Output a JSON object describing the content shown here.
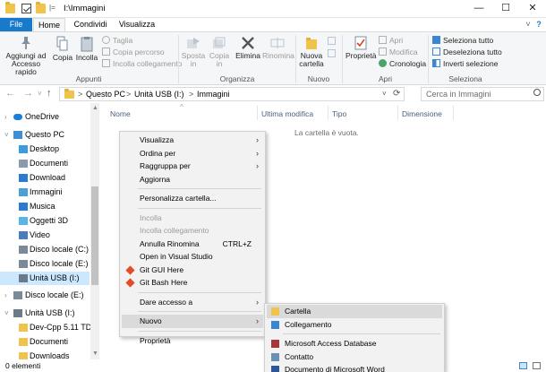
{
  "window": {
    "title": "I:\\Immagini",
    "qa_sep": "|=",
    "btn_min": "—",
    "btn_max": "☐",
    "btn_close": "✕",
    "help": "?"
  },
  "tabs": {
    "file": "File",
    "home": "Home",
    "share": "Condividi",
    "view": "Visualizza"
  },
  "ribbon": {
    "clipboard": {
      "pin": "Aggiungi ad\nAccesso rapido",
      "copy": "Copia",
      "paste": "Incolla",
      "cut": "Taglia",
      "copy_path": "Copia percorso",
      "paste_shortcut": "Incolla collegamento",
      "group": "Appunti"
    },
    "organize": {
      "move_to": "Sposta\nin",
      "copy_to": "Copia\nin",
      "delete": "Elimina",
      "rename": "Rinomina",
      "group": "Organizza"
    },
    "new": {
      "new_folder": "Nuova\ncartella",
      "group": "Nuovo"
    },
    "open": {
      "properties": "Proprietà",
      "open": "Apri",
      "edit": "Modifica",
      "history": "Cronologia",
      "group": "Apri"
    },
    "select": {
      "select_all": "Seleziona tutto",
      "select_none": "Deseleziona tutto",
      "invert": "Inverti selezione",
      "group": "Seleziona"
    }
  },
  "address": {
    "crumbs": [
      "Questo PC",
      "Unità USB (I:)",
      "Immagini"
    ],
    "sep": ">",
    "search_placeholder": "Cerca in Immagini"
  },
  "nav": [
    {
      "label": "OneDrive",
      "icon": "cloud-icon",
      "color": "#1a7fd8",
      "indent": 0
    },
    {
      "label": "Questo PC",
      "icon": "pc-icon",
      "color": "#3b8fd6",
      "indent": 0
    },
    {
      "label": "Desktop",
      "icon": "desktop-icon",
      "color": "#3c9be0",
      "indent": 1
    },
    {
      "label": "Documenti",
      "icon": "documents-icon",
      "color": "#8a9bb0",
      "indent": 1
    },
    {
      "label": "Download",
      "icon": "download-icon",
      "color": "#2a7ad0",
      "indent": 1
    },
    {
      "label": "Immagini",
      "icon": "pictures-icon",
      "color": "#4aa0d9",
      "indent": 1
    },
    {
      "label": "Musica",
      "icon": "music-icon",
      "color": "#2a7ad0",
      "indent": 1
    },
    {
      "label": "Oggetti 3D",
      "icon": "3d-objects-icon",
      "color": "#56b6e8",
      "indent": 1
    },
    {
      "label": "Video",
      "icon": "video-icon",
      "color": "#4a7cc0",
      "indent": 1
    },
    {
      "label": "Disco locale (C:)",
      "icon": "drive-icon",
      "color": "#7a8a9a",
      "indent": 1
    },
    {
      "label": "Disco locale (E:)",
      "icon": "drive-icon",
      "color": "#7a8a9a",
      "indent": 1
    },
    {
      "label": "Unità USB (I:)",
      "icon": "usb-icon",
      "color": "#6b7a88",
      "indent": 1
    },
    {
      "label": "Disco locale (E:)",
      "icon": "drive-icon",
      "color": "#7a8a9a",
      "indent": 0
    },
    {
      "label": "Unità USB (I:)",
      "icon": "usb-icon",
      "color": "#6b7a88",
      "indent": 0
    },
    {
      "label": "Dev-Cpp 5.11 TDM",
      "icon": "folder-icon",
      "color": "#f0c34b",
      "indent": 1
    },
    {
      "label": "Documenti",
      "icon": "folder-icon",
      "color": "#f0c34b",
      "indent": 1
    },
    {
      "label": "Downloads",
      "icon": "folder-icon",
      "color": "#f0c34b",
      "indent": 1
    }
  ],
  "columns": {
    "name": "Nome",
    "modified": "Ultima modifica",
    "type": "Tipo",
    "size": "Dimensione"
  },
  "empty_message": "La cartella è vuota.",
  "status": "0 elementi",
  "context_menu": [
    {
      "label": "Visualizza",
      "arrow": true
    },
    {
      "label": "Ordina per",
      "arrow": true
    },
    {
      "label": "Raggruppa per",
      "arrow": true
    },
    {
      "label": "Aggiorna"
    },
    {
      "sep": true
    },
    {
      "label": "Personalizza cartella..."
    },
    {
      "sep": true
    },
    {
      "label": "Incolla",
      "disabled": true
    },
    {
      "label": "Incolla collegamento",
      "disabled": true
    },
    {
      "label": "Annulla Rinomina",
      "shortcut": "CTRL+Z"
    },
    {
      "label": "Open in Visual Studio"
    },
    {
      "label": "Git GUI Here",
      "icon": "git-icon"
    },
    {
      "label": "Git Bash Here",
      "icon": "git-icon"
    },
    {
      "sep": true
    },
    {
      "label": "Dare accesso a",
      "arrow": true
    },
    {
      "sep": true
    },
    {
      "label": "Nuovo",
      "arrow": true,
      "highlight": true
    },
    {
      "sep": true
    },
    {
      "label": "Proprietà"
    }
  ],
  "submenu": [
    {
      "label": "Cartella",
      "icon": "folder-icon",
      "highlight": true
    },
    {
      "label": "Collegamento",
      "icon": "shortcut-icon"
    },
    {
      "sep": true
    },
    {
      "label": "Microsoft Access Database",
      "icon": "access-icon"
    },
    {
      "label": "Contatto",
      "icon": "contact-icon"
    },
    {
      "label": "Documento di Microsoft Word",
      "icon": "word-icon"
    }
  ]
}
